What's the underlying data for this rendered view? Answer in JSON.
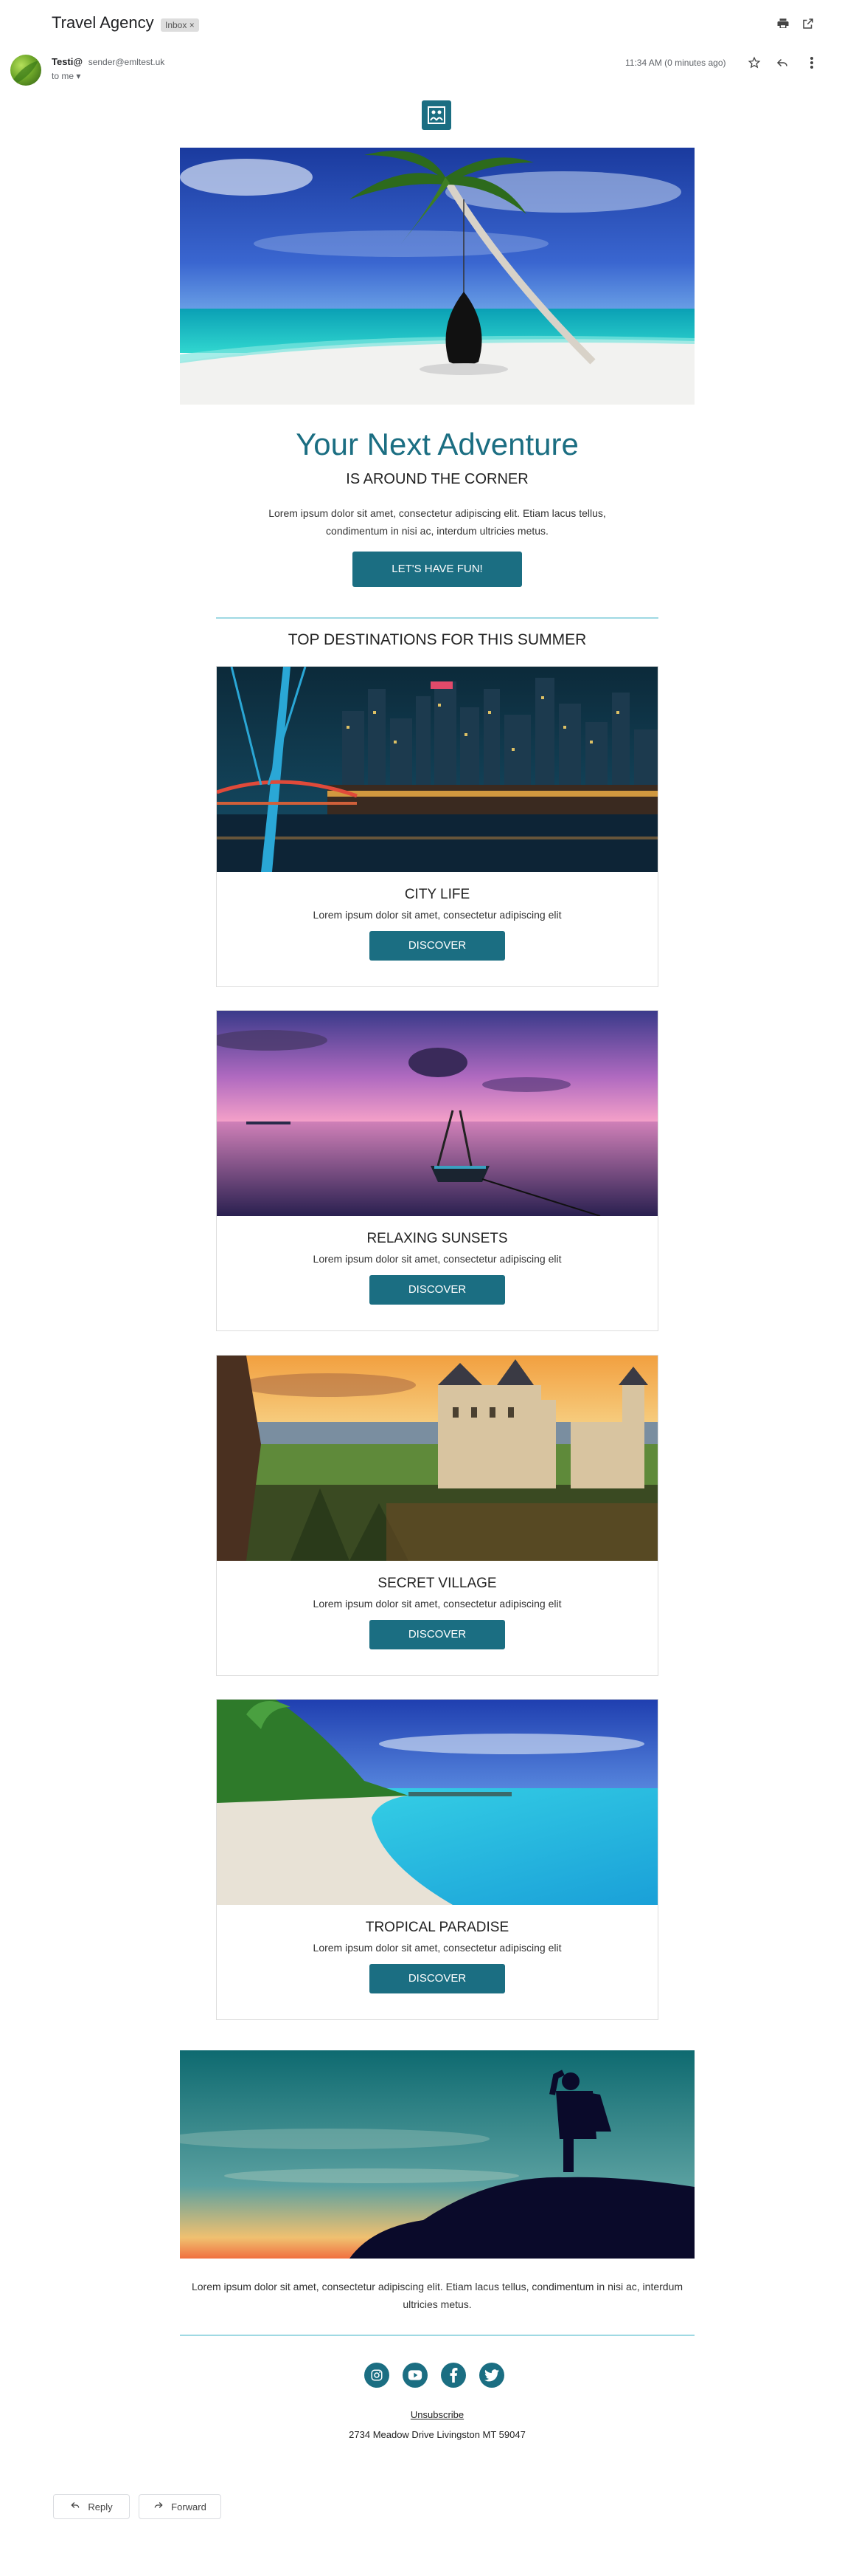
{
  "header": {
    "subject": "Travel Agency",
    "badge": "Inbox ×",
    "sender_name": "Testi@",
    "sender_email": "sender@emltest.uk",
    "to": "to me ▾",
    "timestamp": "11:34 AM (0 minutes ago)",
    "icons": [
      "print-icon",
      "open-in-new-icon",
      "star-icon",
      "reply-icon",
      "more-icon"
    ]
  },
  "email": {
    "hero_title": "Your Next Adventure",
    "hero_subtitle": "IS AROUND THE CORNER",
    "hero_text": "Lorem ipsum dolor sit amet, consectetur adipiscing elit. Etiam lacus tellus, condimentum in nisi ac, interdum ultricies metus.",
    "cta_label": "LET'S HAVE FUN!",
    "destinations_heading": "TOP DESTINATIONS FOR THIS SUMMER",
    "cards": [
      {
        "title": "CITY LIFE",
        "text": "Lorem ipsum dolor sit amet, consectetur adipiscing elit",
        "button": "DISCOVER"
      },
      {
        "title": "RELAXING SUNSETS",
        "text": "Lorem ipsum dolor sit amet, consectetur adipiscing elit",
        "button": "DISCOVER"
      },
      {
        "title": "SECRET VILLAGE",
        "text": "Lorem ipsum dolor sit amet, consectetur adipiscing elit",
        "button": "DISCOVER"
      },
      {
        "title": "TROPICAL PARADISE",
        "text": "Lorem ipsum dolor sit amet, consectetur adipiscing elit",
        "button": "DISCOVER"
      }
    ],
    "footer_text": "Lorem ipsum dolor sit amet, consectetur adipiscing elit. Etiam lacus tellus, condimentum in nisi ac, interdum ultricies metus.",
    "social": [
      "instagram-icon",
      "youtube-icon",
      "facebook-icon",
      "twitter-icon"
    ],
    "unsubscribe": "Unsubscribe",
    "address": "2734 Meadow Drive Livingston MT 59047"
  },
  "actions": {
    "reply": "Reply",
    "forward": "Forward"
  },
  "colors": {
    "accent": "#1b6e82",
    "divider": "#9fd9e3"
  }
}
